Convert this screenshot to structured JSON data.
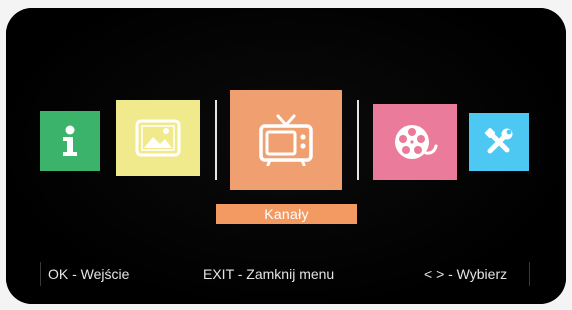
{
  "menu": {
    "items": [
      {
        "icon": "info-icon",
        "color": "#3bb36b"
      },
      {
        "icon": "media-icon",
        "color": "#f1ea8c"
      },
      {
        "icon": "tv-icon",
        "color": "#f0a070",
        "selected": true
      },
      {
        "icon": "film-reel-icon",
        "color": "#ea7b9a"
      },
      {
        "icon": "tools-icon",
        "color": "#4dc8f2"
      }
    ],
    "selected_label": "Kanały"
  },
  "help": {
    "ok": "OK - Wejście",
    "exit": "EXIT - Zamknij menu",
    "navigate": "< > - Wybierz"
  }
}
